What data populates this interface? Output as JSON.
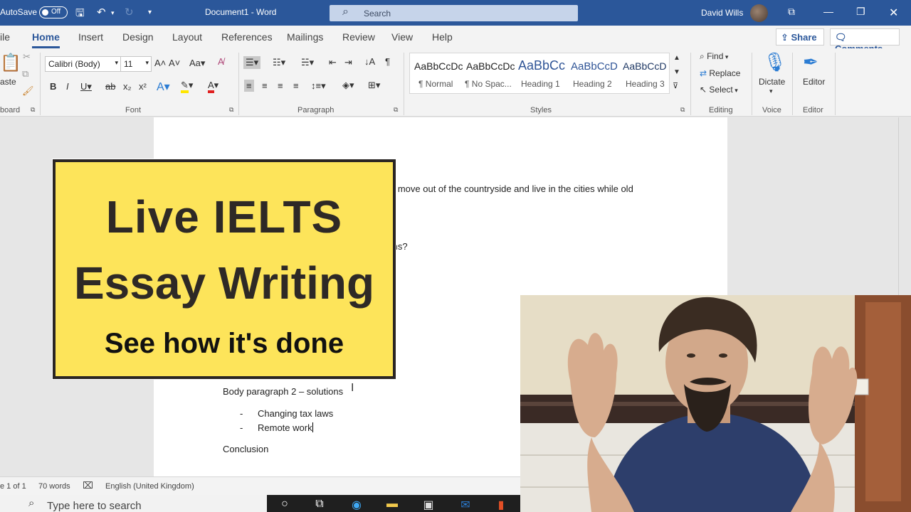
{
  "titlebar": {
    "autosave_label": "AutoSave",
    "autosave_state": "Off",
    "document_title": "Document1  -  Word",
    "search_placeholder": "Search",
    "user_name": "David Wills"
  },
  "tabs": [
    "ile",
    "Home",
    "Insert",
    "Design",
    "Layout",
    "References",
    "Mailings",
    "Review",
    "View",
    "Help"
  ],
  "share_label": "Share",
  "comments_label": "Comments",
  "ribbon": {
    "clipboard": {
      "paste_label": "aste",
      "group_label": "board"
    },
    "font": {
      "family": "Calibri (Body)",
      "size": "11",
      "group_label": "Font"
    },
    "paragraph": {
      "group_label": "Paragraph"
    },
    "styles": {
      "group_label": "Styles",
      "items": [
        {
          "sample": "AaBbCcDc",
          "caption": "¶ Normal"
        },
        {
          "sample": "AaBbCcDc",
          "caption": "¶ No Spac..."
        },
        {
          "sample": "AaBbCc",
          "caption": "Heading 1"
        },
        {
          "sample": "AaBbCcD",
          "caption": "Heading 2"
        },
        {
          "sample": "AaBbCcD",
          "caption": "Heading 3"
        }
      ]
    },
    "editing": {
      "find": "Find",
      "replace": "Replace",
      "select": "Select",
      "group_label": "Editing"
    },
    "voice": {
      "dictate": "Dictate",
      "group_label": "Voice"
    },
    "editor": {
      "label": "Editor",
      "group_label": "Editor"
    }
  },
  "document": {
    "line_top": "o move out of the countryside and live in the cities while old",
    "line_question": "ms?",
    "body2_heading": "Body paragraph 2 – solutions",
    "bullets": [
      "Changing tax laws",
      "Remote work"
    ],
    "conclusion": "Conclusion"
  },
  "banner": {
    "line1": "Live IELTS",
    "line2": "Essay Writing",
    "line3": "See how it's done"
  },
  "status": {
    "page": "e 1 of 1",
    "words": "70 words",
    "language": "English (United Kingdom)"
  },
  "taskbar": {
    "search_placeholder": "Type here to search"
  }
}
